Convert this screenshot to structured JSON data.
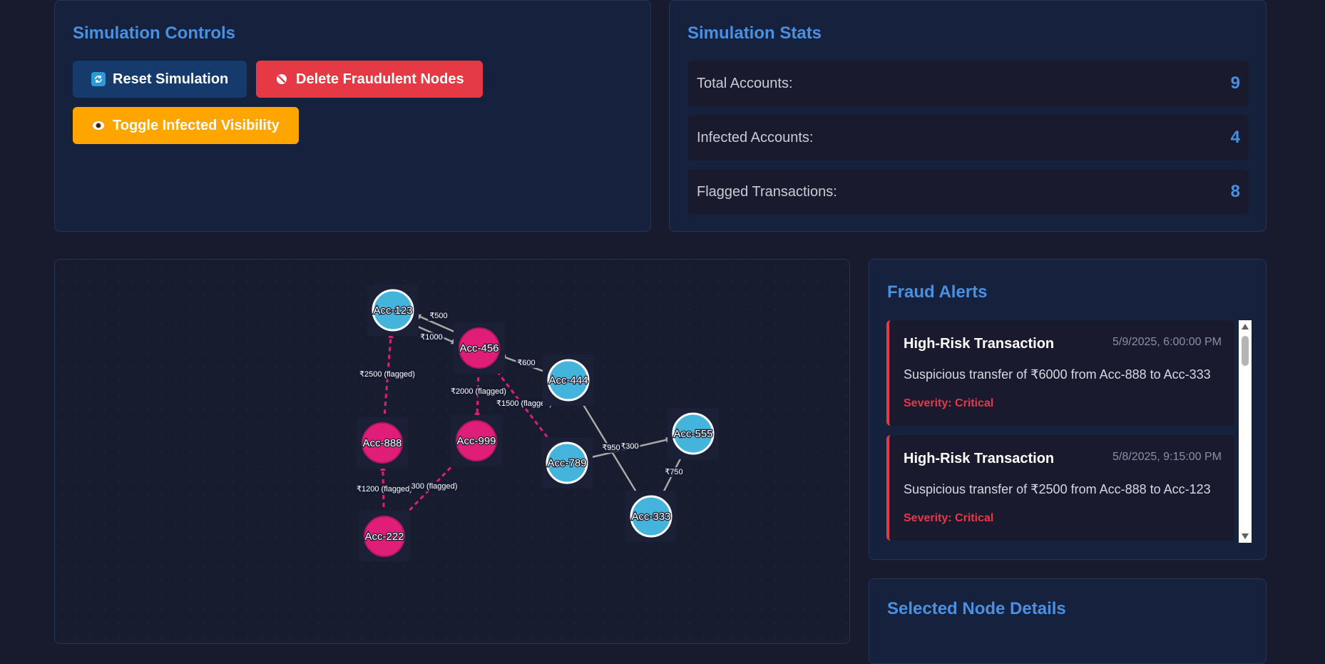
{
  "controls": {
    "title": "Simulation Controls",
    "reset_label": "Reset Simulation",
    "reset_icon": "refresh-icon",
    "delete_label": "Delete Fraudulent Nodes",
    "delete_icon": "prohibited-icon",
    "toggle_label": "Toggle Infected Visibility",
    "toggle_icon": "eye-icon",
    "colors": {
      "reset": "#153a6b",
      "delete": "#e63946",
      "toggle": "#ffa500"
    }
  },
  "stats": {
    "title": "Simulation Stats",
    "rows": [
      {
        "label": "Total Accounts:",
        "value": "9"
      },
      {
        "label": "Infected Accounts:",
        "value": "4"
      },
      {
        "label": "Flagged Transactions:",
        "value": "8"
      }
    ]
  },
  "graph": {
    "colors": {
      "infected": "#e01e79",
      "clean": "#45b4dc",
      "flagged_edge": "#e01e79",
      "normal_edge": "#a8a8a8"
    },
    "nodes": [
      {
        "id": "Acc-123",
        "infected": false
      },
      {
        "id": "Acc-456",
        "infected": true
      },
      {
        "id": "Acc-444",
        "infected": false
      },
      {
        "id": "Acc-888",
        "infected": true
      },
      {
        "id": "Acc-999",
        "infected": true
      },
      {
        "id": "Acc-789",
        "infected": false
      },
      {
        "id": "Acc-555",
        "infected": false
      },
      {
        "id": "Acc-222",
        "infected": true
      },
      {
        "id": "Acc-333",
        "infected": false
      }
    ],
    "edges": [
      {
        "from": "Acc-123",
        "to": "Acc-456",
        "label": "₹500",
        "flagged": false
      },
      {
        "from": "Acc-456",
        "to": "Acc-123",
        "label": "₹1000",
        "flagged": false
      },
      {
        "from": "Acc-444",
        "to": "Acc-456",
        "label": "₹600",
        "flagged": false
      },
      {
        "from": "Acc-888",
        "to": "Acc-123",
        "label": "₹2500 (flagged)",
        "flagged": true
      },
      {
        "from": "Acc-456",
        "to": "Acc-999",
        "label": "₹2000 (flagged)",
        "flagged": true
      },
      {
        "from": "Acc-456",
        "to": "Acc-789",
        "label": "₹1500 (flagged)",
        "flagged": true
      },
      {
        "from": "Acc-222",
        "to": "Acc-888",
        "label": "₹1200 (flagged)",
        "flagged": true
      },
      {
        "from": "Acc-999",
        "to": "Acc-222",
        "label": "300 (flagged)",
        "flagged": true
      },
      {
        "from": "Acc-789",
        "to": "Acc-555",
        "label": "₹300",
        "flagged": false
      },
      {
        "from": "Acc-333",
        "to": "Acc-444",
        "label": "₹950",
        "flagged": false
      },
      {
        "from": "Acc-555",
        "to": "Acc-333",
        "label": "₹750",
        "flagged": false
      }
    ]
  },
  "alerts": {
    "title": "Fraud Alerts",
    "items": [
      {
        "title": "High-Risk Transaction",
        "time": "5/9/2025, 6:00:00 PM",
        "message": "Suspicious transfer of ₹6000 from Acc-888 to Acc-333",
        "severity": "Severity: Critical"
      },
      {
        "title": "High-Risk Transaction",
        "time": "5/8/2025, 9:15:00 PM",
        "message": "Suspicious transfer of ₹2500 from Acc-888 to Acc-123",
        "severity": "Severity: Critical"
      }
    ]
  },
  "details": {
    "title": "Selected Node Details"
  }
}
